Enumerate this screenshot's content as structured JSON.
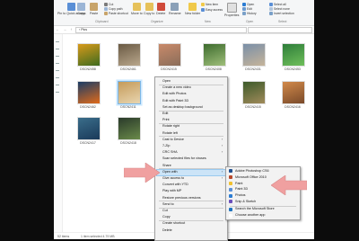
{
  "ribbon": {
    "pin_label": "Pin to Quick access",
    "copy_label": "Copy",
    "paste_label": "Paste",
    "cut_label": "Cut",
    "copy_path_label": "Copy path",
    "paste_shortcut_label": "Paste shortcut",
    "move_to_label": "Move to",
    "copy_to_label": "Copy to",
    "delete_label": "Delete",
    "rename_label": "Rename",
    "new_folder_label": "New folder",
    "new_item_label": "New item",
    "easy_access_label": "Easy access",
    "properties_label": "Properties",
    "open_label": "Open",
    "edit_label": "Edit",
    "history_label": "History",
    "select_all_label": "Select all",
    "select_none_label": "Select none",
    "invert_selection_label": "Invert selection",
    "group_clipboard": "Clipboard",
    "group_organize": "Organize",
    "group_new": "New",
    "group_open": "Open",
    "group_select": "Select"
  },
  "address": {
    "path": "Pics"
  },
  "files": [
    {
      "name": "DSCN2458",
      "color1": "#d89a1a",
      "color2": "#3e6b1f"
    },
    {
      "name": "DSCN2461",
      "color1": "#6a5a44",
      "color2": "#b9a78c"
    },
    {
      "name": "DSCN2415",
      "color1": "#c98a6a",
      "color2": "#8a6d5a"
    },
    {
      "name": "DSCN2408",
      "color1": "#3d6b2e",
      "color2": "#9fbf7a"
    },
    {
      "name": "DSCN2431",
      "color1": "#7a8fa8",
      "color2": "#c6b49a"
    },
    {
      "name": "DSCN2453",
      "color1": "#2e7d3a",
      "color2": "#6fbf5a"
    },
    {
      "name": "DSCN2462",
      "color1": "#1a3c66",
      "color2": "#e06a1a"
    },
    {
      "name": "DSCN2411",
      "color1": "#c59b5a",
      "color2": "#e8d5b0"
    },
    {
      "name": "DSCN2410",
      "color1": "#8fd0cf",
      "color2": "#b7dcb8"
    },
    {
      "name": "DSCN2412",
      "color1": "#e86a2e",
      "color2": "#f2b84a"
    },
    {
      "name": "DSCN2415",
      "color1": "#3d5a2a",
      "color2": "#a08a5a"
    },
    {
      "name": "DSCN2416",
      "color1": "#d28a4a",
      "color2": "#7a4a2a"
    },
    {
      "name": "DSCN2417",
      "color1": "#3a6d8a",
      "color2": "#1a3a5a"
    },
    {
      "name": "DSCN2418",
      "color1": "#2a3a2a",
      "color2": "#6a8a4a"
    }
  ],
  "context_menu": {
    "items": [
      "Open",
      "Create a new video",
      "Edit with Photos",
      "Edit with Paint 3D",
      "Set as desktop background",
      "Edit",
      "Print",
      "Rotate right",
      "Rotate left",
      "Cast to Device",
      "7-Zip",
      "CRC SHA",
      "Scan selected files for viruses",
      "Share",
      "Open with",
      "Give access to",
      "Convert with YTD",
      "Play with MP",
      "Restore previous versions",
      "Send to",
      "Cut",
      "Copy",
      "Create shortcut",
      "Delete"
    ]
  },
  "submenu": {
    "items": [
      "Adobe Photoshop CS6",
      "Microsoft Office 2010",
      "Paint",
      "Paint 3D",
      "Photos",
      "Snip & Sketch",
      "Search the Microsoft Store",
      "Choose another app"
    ],
    "icon_colors": [
      "#1f4f8f",
      "#b7472a",
      "#f2c12e",
      "#5a8fd6",
      "#2b7cd3",
      "#6b4fbb",
      "#1e73be",
      "#ffffff"
    ]
  },
  "status": {
    "count": "52 items",
    "selected": "1 item selected  4.79 MB"
  },
  "colors": {
    "highlight": "#cce4f7",
    "arrow": "#f0a0a0"
  }
}
